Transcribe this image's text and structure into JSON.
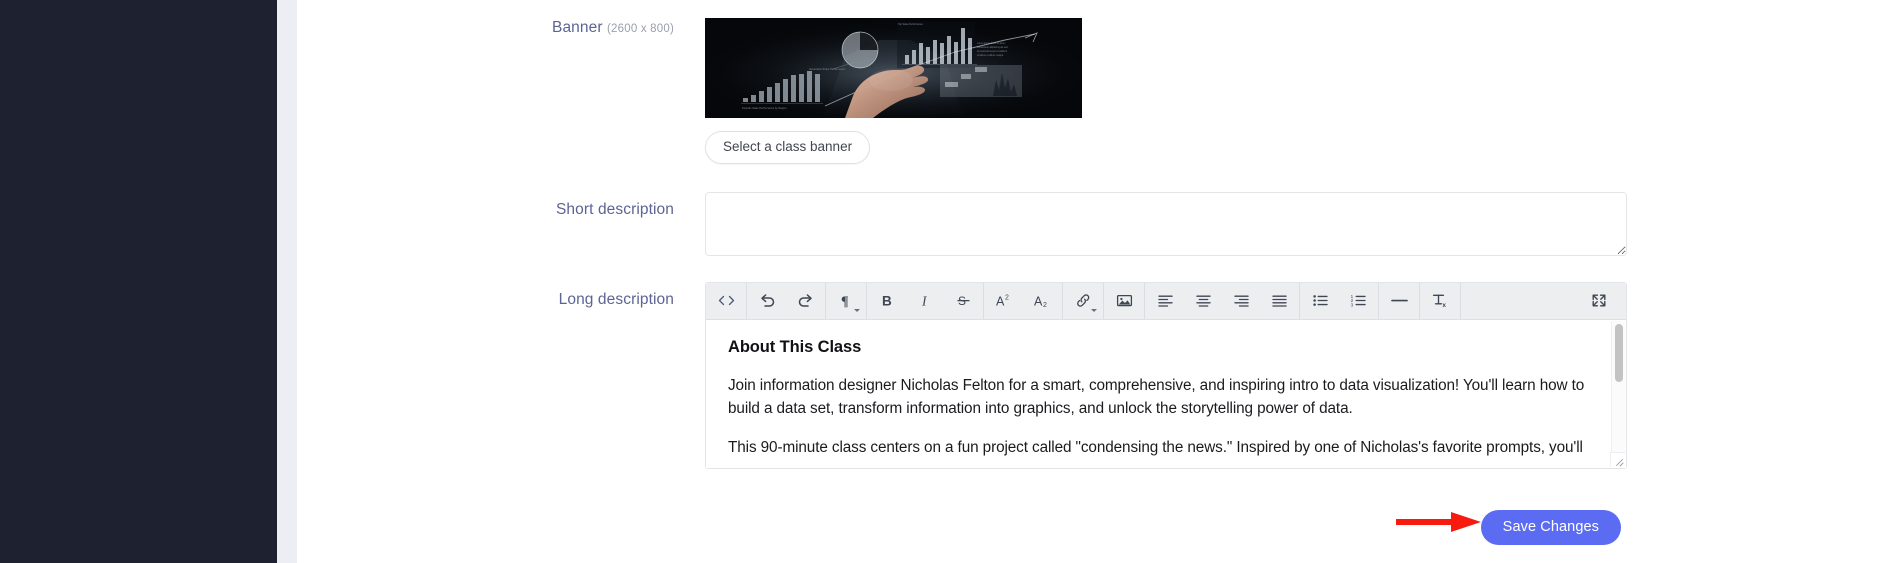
{
  "sidebar": {
    "background": "#1e2130"
  },
  "theme": {
    "label_color": "#5d6494",
    "accent": "#5c6cf2",
    "annotation": "#f61b0e",
    "toolbar_bg": "#eceef0"
  },
  "form": {
    "banner": {
      "label": "Banner",
      "dimensions": "(2600 x 800)",
      "select_button": "Select a class banner",
      "image_alt": "Businessman holding holographic data visualization charts"
    },
    "short_description": {
      "label": "Short description",
      "value": "",
      "placeholder": ""
    },
    "long_description": {
      "label": "Long description",
      "toolbar": [
        {
          "group": 1,
          "items": [
            {
              "name": "code-view-icon",
              "label": "<>"
            }
          ]
        },
        {
          "group": 2,
          "items": [
            {
              "name": "undo-icon",
              "label": "Undo"
            },
            {
              "name": "redo-icon",
              "label": "Redo"
            }
          ]
        },
        {
          "group": 3,
          "items": [
            {
              "name": "paragraph-format-icon",
              "label": "Paragraph Format",
              "has_dropdown": true
            }
          ]
        },
        {
          "group": 4,
          "items": [
            {
              "name": "bold-icon",
              "label": "B"
            },
            {
              "name": "italic-icon",
              "label": "I"
            },
            {
              "name": "strikethrough-icon",
              "label": "S"
            }
          ]
        },
        {
          "group": 5,
          "items": [
            {
              "name": "superscript-icon",
              "label": "A2"
            },
            {
              "name": "subscript-icon",
              "label": "A2"
            }
          ]
        },
        {
          "group": 6,
          "items": [
            {
              "name": "insert-link-icon",
              "label": "Insert Link",
              "has_dropdown": true
            }
          ]
        },
        {
          "group": 7,
          "items": [
            {
              "name": "insert-image-icon",
              "label": "Insert Image"
            }
          ]
        },
        {
          "group": 8,
          "items": [
            {
              "name": "align-left-icon",
              "label": "Align Left"
            },
            {
              "name": "align-center-icon",
              "label": "Align Center"
            },
            {
              "name": "align-right-icon",
              "label": "Align Right"
            },
            {
              "name": "align-justify-icon",
              "label": "Align Justify"
            }
          ]
        },
        {
          "group": 9,
          "items": [
            {
              "name": "unordered-list-icon",
              "label": "Bulleted List"
            },
            {
              "name": "ordered-list-icon",
              "label": "Numbered List"
            }
          ]
        },
        {
          "group": 10,
          "items": [
            {
              "name": "horizontal-rule-icon",
              "label": "Horizontal Line"
            }
          ]
        },
        {
          "group": 11,
          "items": [
            {
              "name": "clear-formatting-icon",
              "label": "Clear Formatting"
            }
          ]
        },
        {
          "group": 12,
          "items": [
            {
              "name": "fullscreen-icon",
              "label": "Fullscreen"
            }
          ]
        }
      ],
      "content": {
        "heading": "About This Class",
        "paragraph_1": "Join information designer Nicholas Felton for a smart, comprehensive, and inspiring intro to data visualization! You'll learn how to build a data set, transform information into graphics, and unlock the storytelling power of data.",
        "paragraph_2": "This 90-minute class centers on a fun project called \"condensing the news.\" Inspired by one of Nicholas's favorite prompts, you'll"
      }
    }
  },
  "footer": {
    "save_label": "Save Changes"
  }
}
